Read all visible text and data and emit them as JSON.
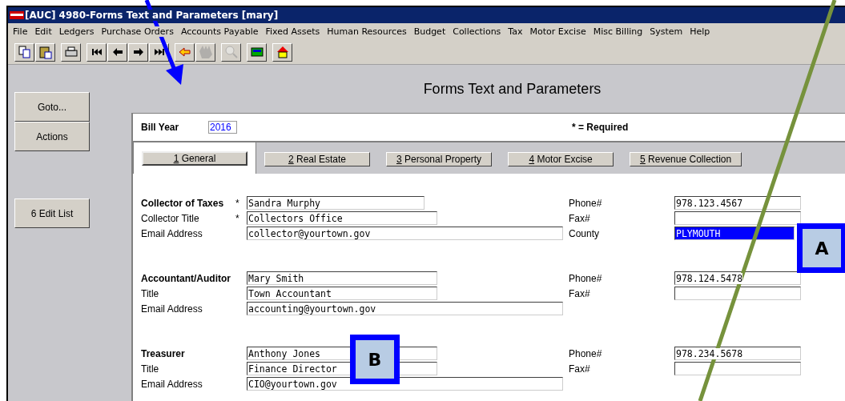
{
  "window": {
    "title": "[AUC] 4980-Forms Text and Parameters [mary]"
  },
  "menu": [
    "File",
    "Edit",
    "Ledgers",
    "Purchase Orders",
    "Accounts Payable",
    "Fixed Assets",
    "Human Resources",
    "Budget",
    "Collections",
    "Tax",
    "Motor Excise",
    "Misc Billing",
    "System",
    "Help"
  ],
  "toolbar": [
    {
      "kind": "copy",
      "disabled": false
    },
    {
      "kind": "paste",
      "disabled": false
    },
    {
      "kind": "print",
      "disabled": false
    },
    {
      "kind": "first",
      "disabled": false
    },
    {
      "kind": "prev",
      "disabled": false
    },
    {
      "kind": "next",
      "disabled": false
    },
    {
      "kind": "last",
      "disabled": false
    },
    {
      "kind": "exit",
      "disabled": false
    },
    {
      "kind": "hand",
      "disabled": true
    },
    {
      "kind": "search",
      "disabled": true
    },
    {
      "kind": "calc",
      "disabled": false
    },
    {
      "kind": "home",
      "disabled": false
    }
  ],
  "side_buttons": [
    {
      "label": "Goto..."
    },
    {
      "label": "Actions"
    },
    {
      "label": "6 Edit List"
    }
  ],
  "page_title": "Forms Text and Parameters",
  "bill_year": {
    "label": "Bill Year",
    "value": "2016"
  },
  "required_note": "* = Required",
  "tabs": [
    {
      "key": "1",
      "label": " General",
      "selected": true
    },
    {
      "key": "2",
      "label": " Real Estate",
      "selected": false
    },
    {
      "key": "3",
      "label": " Personal Property",
      "selected": false
    },
    {
      "key": "4",
      "label": " Motor Excise",
      "selected": false
    },
    {
      "key": "5",
      "label": " Revenue Collection",
      "selected": false
    }
  ],
  "sections": [
    {
      "rows": [
        {
          "label": "Collector of Taxes",
          "bold": true,
          "mark": "*",
          "value": "Sandra Murphy",
          "right_label": "Phone#",
          "right_value": "978.123.4567",
          "highlighted": false
        },
        {
          "label": "Collector Title",
          "bold": false,
          "mark": "*",
          "value": "Collectors Office",
          "right_label": "Fax#",
          "highlighted": false
        },
        {
          "label": "Email Address",
          "bold": false,
          "value": "collector@yourtown.gov",
          "right_label": "County",
          "right_value": "PLYMOUTH",
          "highlighted": true
        }
      ]
    },
    {
      "rows": [
        {
          "label": "Accountant/Auditor",
          "bold": true,
          "value": "Mary Smith",
          "right_label": "Phone#",
          "right_value": "978.124.5478",
          "highlighted": false
        },
        {
          "label": "Title",
          "bold": false,
          "value": "Town Accountant",
          "right_label": "Fax#",
          "highlighted": false
        },
        {
          "label": "Email Address",
          "bold": false,
          "value": "accounting@yourtown.gov"
        }
      ]
    },
    {
      "rows": [
        {
          "label": "Treasurer",
          "bold": true,
          "value": "Anthony Jones",
          "right_label": "Phone#",
          "right_value": "978.234.5678",
          "highlighted": false
        },
        {
          "label": "Title",
          "bold": false,
          "value": "Finance Director",
          "right_label": "Fax#",
          "highlighted": false
        },
        {
          "label": "Email Address",
          "bold": false,
          "value": "CIO@yourtown.gov"
        }
      ]
    }
  ],
  "callouts": [
    {
      "label": "A"
    },
    {
      "label": "B"
    }
  ]
}
